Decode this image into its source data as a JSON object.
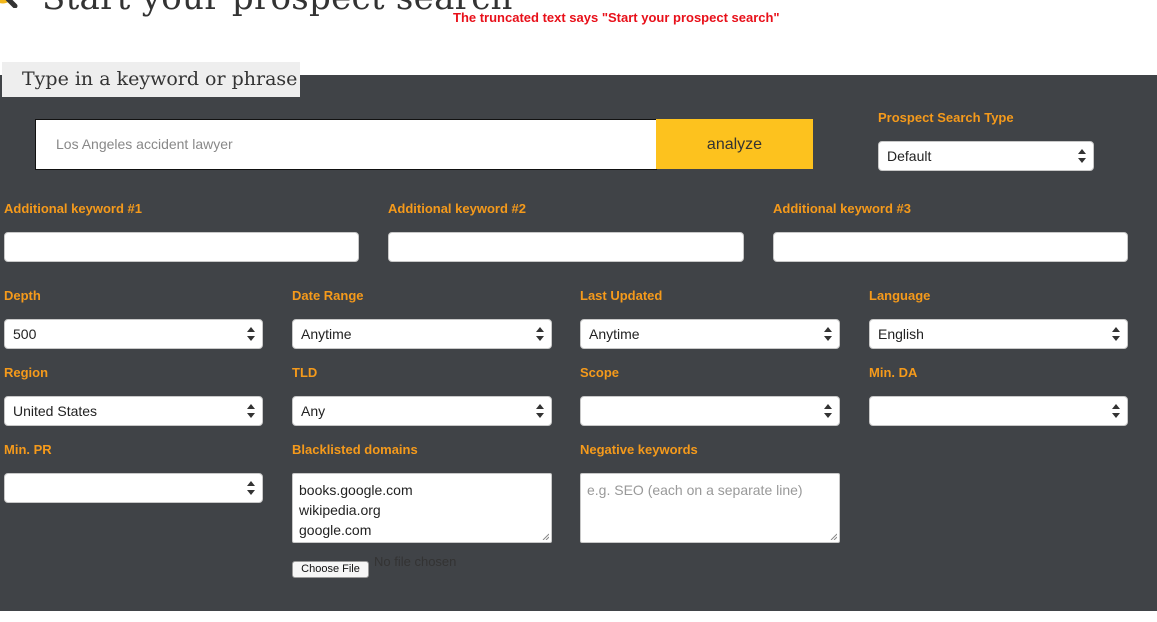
{
  "header": {
    "title": "Start your prospect search",
    "annotation": "The truncated text says \"Start your prospect search\""
  },
  "search": {
    "tab_label": "Type in a keyword or phrase",
    "keyword_value": "Los Angeles accident lawyer",
    "analyze_label": "analyze"
  },
  "fields": {
    "search_type": {
      "label": "Prospect Search Type",
      "value": "Default"
    },
    "additional_1": {
      "label": "Additional keyword #1",
      "value": ""
    },
    "additional_2": {
      "label": "Additional keyword #2",
      "value": ""
    },
    "additional_3": {
      "label": "Additional keyword #3",
      "value": ""
    },
    "depth": {
      "label": "Depth",
      "value": "500"
    },
    "date_range": {
      "label": "Date Range",
      "value": "Anytime"
    },
    "last_updated": {
      "label": "Last Updated",
      "value": "Anytime"
    },
    "language": {
      "label": "Language",
      "value": "English"
    },
    "region": {
      "label": "Region",
      "value": "United States"
    },
    "tld": {
      "label": "TLD",
      "value": "Any"
    },
    "scope": {
      "label": "Scope",
      "value": ""
    },
    "min_da": {
      "label": "Min. DA",
      "value": ""
    },
    "min_pr": {
      "label": "Min. PR",
      "value": ""
    },
    "blacklisted": {
      "label": "Blacklisted domains",
      "lines": [
        "books.google.com",
        "wikipedia.org",
        "google.com"
      ]
    },
    "negative": {
      "label": "Negative keywords",
      "placeholder": "e.g. SEO (each on a separate line)"
    }
  },
  "file_upload": {
    "button_label": "Choose File",
    "status": "No file chosen"
  },
  "colors": {
    "panel_bg": "#404347",
    "label_orange": "#f59a1b",
    "analyze_yellow": "#fdc21e",
    "annotation_red": "#e8101a"
  },
  "icons": {
    "header": "search-icon",
    "select_arrows": "updown-arrows-icon"
  }
}
